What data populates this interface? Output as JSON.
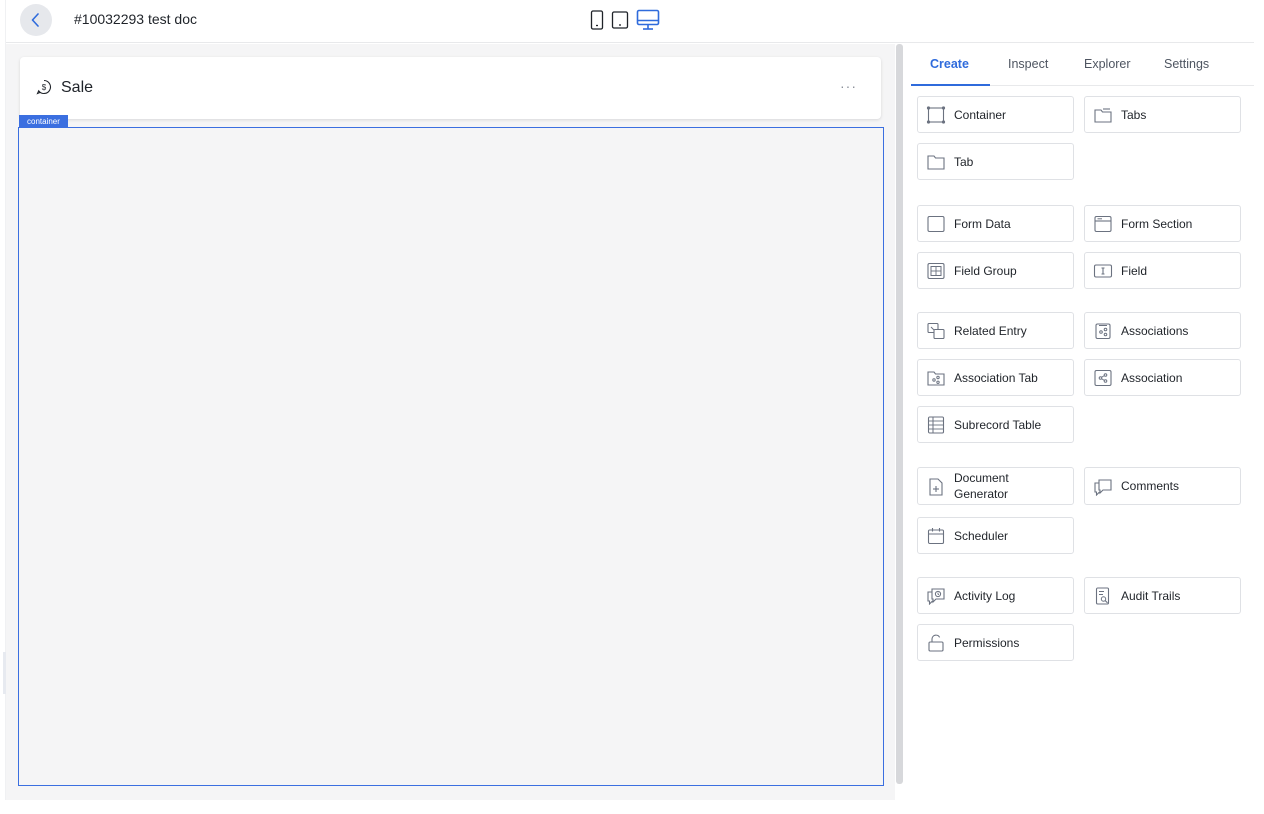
{
  "header": {
    "doc_title": "#10032293  test doc",
    "device_buttons": [
      "phone-icon",
      "tablet-icon",
      "desktop-icon"
    ],
    "active_device": "desktop"
  },
  "canvas": {
    "record_title": "Sale",
    "more_label": "···",
    "container_tag": "container"
  },
  "panel": {
    "tabs": [
      {
        "label": "Create",
        "active": true
      },
      {
        "label": "Inspect",
        "active": false
      },
      {
        "label": "Explorer",
        "active": false
      },
      {
        "label": "Settings",
        "active": false
      }
    ],
    "components": [
      {
        "label": "Container",
        "icon": "container-icon"
      },
      {
        "label": "Tabs",
        "icon": "tabs-icon"
      },
      {
        "label": "Tab",
        "icon": "tab-icon"
      },
      {
        "label": "Form Data",
        "icon": "form-data-icon"
      },
      {
        "label": "Form Section",
        "icon": "form-section-icon"
      },
      {
        "label": "Field Group",
        "icon": "field-group-icon"
      },
      {
        "label": "Field",
        "icon": "field-icon"
      },
      {
        "label": "Related Entry",
        "icon": "related-entry-icon"
      },
      {
        "label": "Associations",
        "icon": "associations-icon"
      },
      {
        "label": "Association Tab",
        "icon": "association-tab-icon"
      },
      {
        "label": "Association",
        "icon": "association-icon"
      },
      {
        "label": "Subrecord Table",
        "icon": "subrecord-table-icon"
      },
      {
        "label_line1": "Document",
        "label_line2": "Generator",
        "icon": "document-generator-icon"
      },
      {
        "label": "Comments",
        "icon": "comments-icon"
      },
      {
        "label": "Scheduler",
        "icon": "scheduler-icon"
      },
      {
        "label": "Activity Log",
        "icon": "activity-log-icon"
      },
      {
        "label": "Audit Trails",
        "icon": "audit-trails-icon"
      },
      {
        "label": "Permissions",
        "icon": "permissions-icon"
      }
    ]
  },
  "colors": {
    "accent": "#2f6bdc",
    "container_border": "#3b6fe0",
    "canvas_bg": "#f5f5f6"
  }
}
